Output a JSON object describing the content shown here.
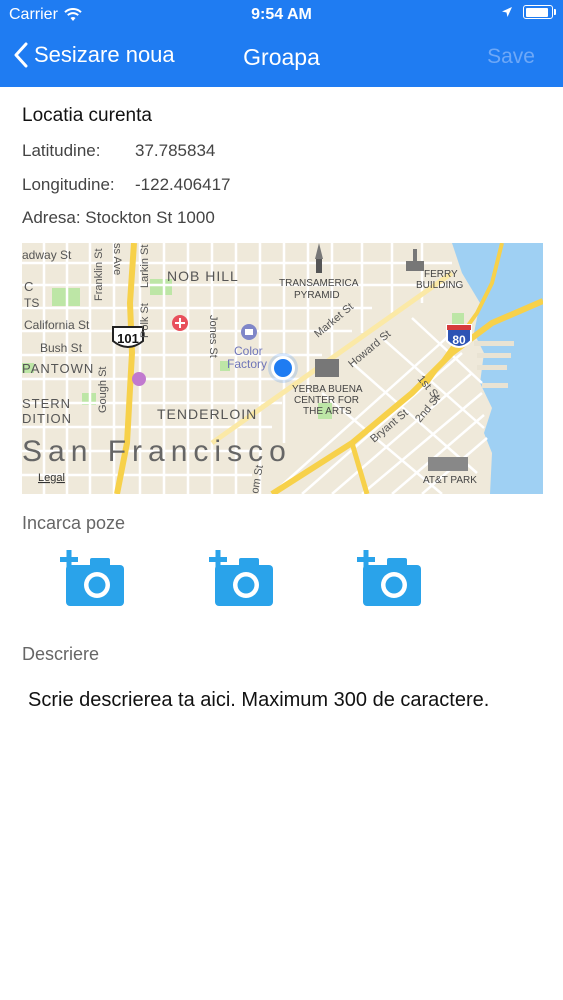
{
  "status": {
    "carrier": "Carrier",
    "time": "9:54 AM"
  },
  "nav": {
    "back_label": "Sesizare noua",
    "title": "Groapa",
    "save_label": "Save"
  },
  "location": {
    "section_title": "Locatia curenta",
    "latitude_label": "Latitudine:",
    "latitude_value": "37.785834",
    "longitude_label": "Longitudine:",
    "longitude_value": "-122.406417",
    "address_text": "Adresa: Stockton St 1000"
  },
  "map": {
    "city_label": "San Francisco",
    "legal_label": "Legal",
    "labels": {
      "nob_hill": "NOB HILL",
      "transamerica": "TRANSAMERICA",
      "pyramid": "PYRAMID",
      "ferry": "FERRY",
      "building": "BUILDING",
      "california_st": "California St",
      "bush_st": "Bush St",
      "pantown": "PANTOWN",
      "stern": "STERN",
      "dition": "DITION",
      "tenderloin": "TENDERLOIN",
      "yerba": "YERBA BUENA",
      "center_for": "CENTER FOR",
      "the_arts": "THE ARTS",
      "color": "Color",
      "factory": "Factory",
      "att_park": "AT&T PARK",
      "highway_101": "101",
      "highway_80": "80",
      "market_st": "Market St",
      "howard_st": "Howard St",
      "bryant_st": "Bryant St",
      "second_st": "2nd St",
      "first_st": "1st St",
      "jones_st": "Jones St",
      "larkin_st": "Larkin St",
      "polk_st": "Polk St",
      "franklin_st": "Franklin St",
      "gough_st": "Gough St",
      "ness_ave": "ss Ave",
      "broadway_st": "adway St",
      "letter_c": "C",
      "letter_ts": "TS",
      "sm_st": "om St"
    },
    "colors": {
      "land": "#efe9da",
      "water": "#9fd0f3",
      "park": "#bde6a6",
      "street": "#ffffff",
      "highway": "#f7d14a",
      "pin": "#1f7cf2"
    }
  },
  "photos": {
    "label": "Incarca poze",
    "icon_color": "#2aa3ea"
  },
  "description": {
    "label": "Descriere",
    "placeholder": "Scrie descrierea ta aici. Maximum 300 de caractere."
  }
}
